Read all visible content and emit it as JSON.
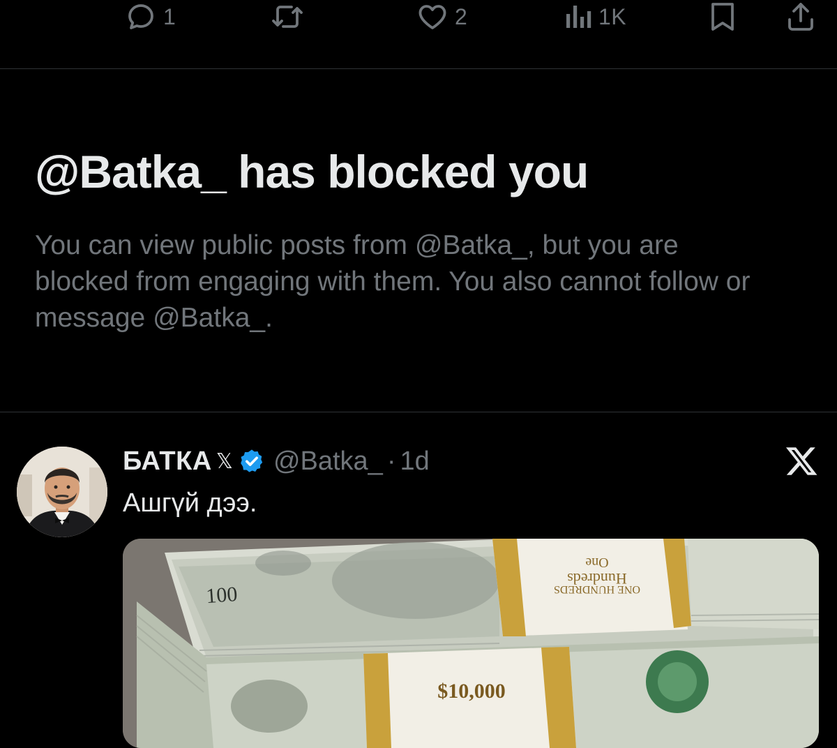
{
  "actions": {
    "reply_count": "1",
    "like_count": "2",
    "views_count": "1K",
    "icons": [
      "reply-icon",
      "retweet-icon",
      "like-icon",
      "views-icon",
      "bookmark-icon",
      "share-icon"
    ]
  },
  "blocked": {
    "title": "@Batka_ has blocked you",
    "description": "You can view public posts from @Batka_, but you are blocked from engaging with them. You also cannot follow or message @Batka_."
  },
  "tweet": {
    "display_name": "БАТКА",
    "x_badge": "𝕏",
    "handle": "@Batka_",
    "separator": "·",
    "time": "1d",
    "text": "Ашгүй дээ.",
    "media_labels": {
      "band_top_1": "Hundreds",
      "band_top_2": "One",
      "band_top_3": "ONE HUNDREDS",
      "band_bottom": "$10,000",
      "bill_denomination": "100"
    }
  },
  "colors": {
    "background": "#000000",
    "text_primary": "#e7e9ea",
    "text_secondary": "#71767b",
    "divider": "#2f3336",
    "verified_blue": "#1d9bf0",
    "band_gold": "#c9a13c"
  }
}
